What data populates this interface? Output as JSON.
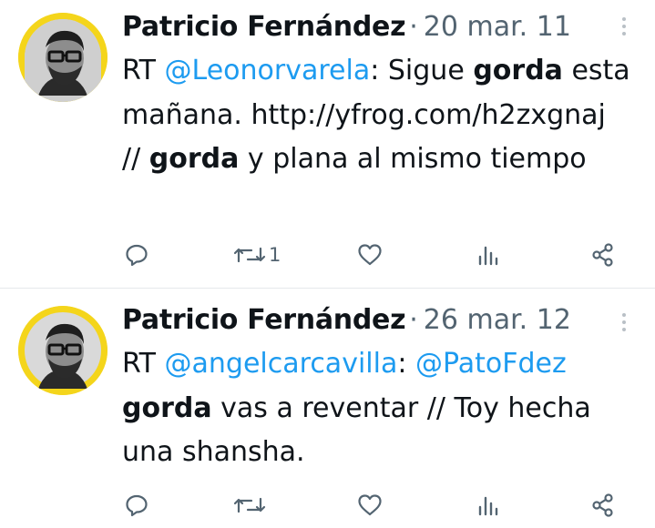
{
  "tweets": [
    {
      "author": "Patricio Fernández",
      "separator": "·",
      "date": "20 mar. 11",
      "text": {
        "rt": "RT ",
        "mention1": "@Leonorvarela",
        "p1": ": Sigue ",
        "em1": "gorda",
        "p2": " esta mañana. http://yfrog.com/h2zxgnaj // ",
        "em2": "gorda",
        "p3": " y plana al mismo tiempo"
      },
      "retweet_count": "1",
      "avatar_bg": "#f4d51b"
    },
    {
      "author": "Patricio Fernández",
      "separator": "·",
      "date": "26 mar. 12",
      "text": {
        "rt": "RT ",
        "mention1": "@angelcarcavilla",
        "p1": ": ",
        "mention2": "@PatoFdez",
        "p2": " ",
        "em1": "gorda",
        "p3": " vas a reventar // Toy hecha una shansha."
      },
      "retweet_count": "",
      "avatar_bg": "#f4d51b"
    }
  ],
  "icons": [
    "reply-icon",
    "retweet-icon",
    "like-icon",
    "views-icon",
    "share-icon",
    "more-icon"
  ],
  "colors": {
    "link": "#1d9bf0",
    "muted": "#536471",
    "text": "#0f1419",
    "divider": "#e6e9eb"
  }
}
